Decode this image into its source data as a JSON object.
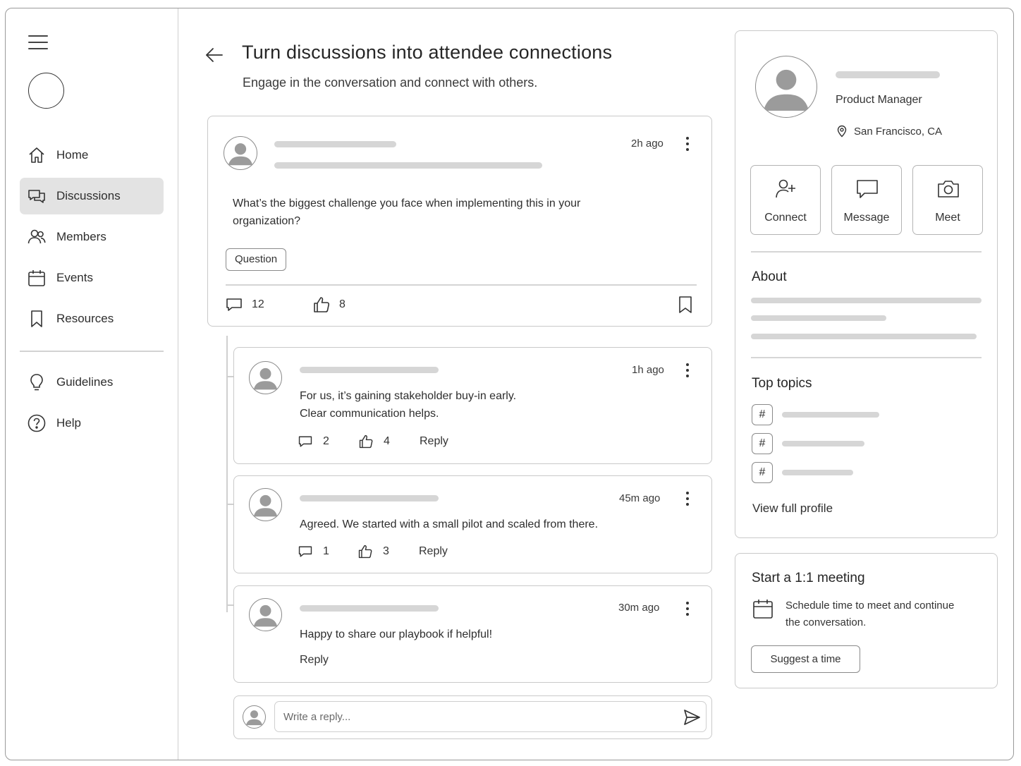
{
  "sidebar": {
    "nav": [
      {
        "label": "Home",
        "icon": "home-icon",
        "active": false
      },
      {
        "label": "Discussions",
        "icon": "discussions-icon",
        "active": true
      },
      {
        "label": "Members",
        "icon": "members-icon",
        "active": false
      },
      {
        "label": "Events",
        "icon": "calendar-icon",
        "active": false
      },
      {
        "label": "Resources",
        "icon": "bookmark-icon",
        "active": false
      }
    ],
    "secondary": [
      {
        "label": "Guidelines",
        "icon": "lightbulb-icon"
      },
      {
        "label": "Help",
        "icon": "help-icon"
      }
    ]
  },
  "header": {
    "title": "Turn discussions into attendee connections",
    "subtitle": "Engage in the conversation and connect with others."
  },
  "post": {
    "time": "2h ago",
    "text": "What’s the biggest challenge you face when implementing this in your organization?",
    "tag": "Question",
    "comments": "12",
    "likes": "8"
  },
  "replies": [
    {
      "time": "1h ago",
      "text_line1": "For us, it’s gaining stakeholder buy-in early.",
      "text_line2": "Clear communication helps.",
      "comments": "2",
      "likes": "4",
      "reply_label": "Reply"
    },
    {
      "time": "45m ago",
      "text_line1": "Agreed. We started with a small pilot and scaled from there.",
      "comments": "1",
      "likes": "3",
      "reply_label": "Reply"
    },
    {
      "time": "30m ago",
      "text_line1": "Happy to share our playbook if helpful!",
      "reply_label": "Reply"
    }
  ],
  "composer": {
    "placeholder": "Write a reply..."
  },
  "profile": {
    "role": "Product Manager",
    "location": "San Francisco, CA",
    "actions": [
      {
        "label": "Connect",
        "icon": "add-user-icon"
      },
      {
        "label": "Message",
        "icon": "message-icon"
      },
      {
        "label": "Meet",
        "icon": "camera-icon"
      }
    ],
    "about_title": "About",
    "topics_title": "Top topics",
    "topic_symbol": "#",
    "view_profile": "View full profile"
  },
  "meeting": {
    "title": "Start a 1:1 meeting",
    "description": "Schedule time to meet and continue the conversation.",
    "button": "Suggest a time"
  },
  "colors": {
    "active_nav_bg": "#e3e3e3",
    "border": "#c9c9c9",
    "skeleton": "#d6d6d6"
  }
}
